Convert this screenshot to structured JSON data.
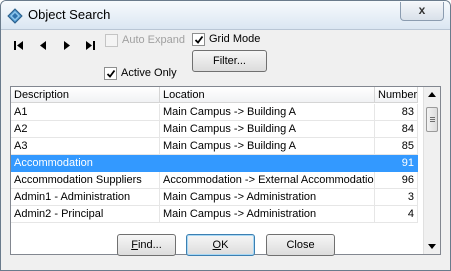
{
  "window": {
    "title": "Object Search",
    "close_label": "x",
    "icon": "app-diamond-icon"
  },
  "navigation": {
    "first_icon": "first-record-icon",
    "prev_icon": "previous-record-icon",
    "next_icon": "next-record-icon",
    "last_icon": "last-record-icon"
  },
  "options": {
    "auto_expand": {
      "label": "Auto Expand",
      "checked": false,
      "enabled": false
    },
    "grid_mode": {
      "label": "Grid Mode",
      "checked": true,
      "enabled": true
    },
    "active_only": {
      "label": "Active Only",
      "checked": true,
      "enabled": true
    },
    "filter_button": "Filter..."
  },
  "grid": {
    "columns": [
      "Description",
      "Location",
      "Number"
    ],
    "rows": [
      {
        "description": "A1",
        "location": "Main Campus -> Building A",
        "number": "83",
        "selected": false
      },
      {
        "description": "A2",
        "location": "Main Campus -> Building A",
        "number": "84",
        "selected": false
      },
      {
        "description": "A3",
        "location": "Main Campus -> Building A",
        "number": "85",
        "selected": false
      },
      {
        "description": "Accommodation",
        "location": "",
        "number": "91",
        "selected": true
      },
      {
        "description": "Accommodation Suppliers",
        "location": "Accommodation -> External Accommodation",
        "number": "96",
        "selected": false
      },
      {
        "description": "Admin1 - Administration",
        "location": "Main Campus -> Administration",
        "number": "3",
        "selected": false
      },
      {
        "description": "Admin2 - Principal",
        "location": "Main Campus -> Administration",
        "number": "4",
        "selected": false
      }
    ]
  },
  "footer": {
    "find_button": "Find...",
    "ok_button": "OK",
    "close_button": "Close"
  },
  "colors": {
    "selection": "#3399ff",
    "window_bg": "#f0f0f0"
  }
}
